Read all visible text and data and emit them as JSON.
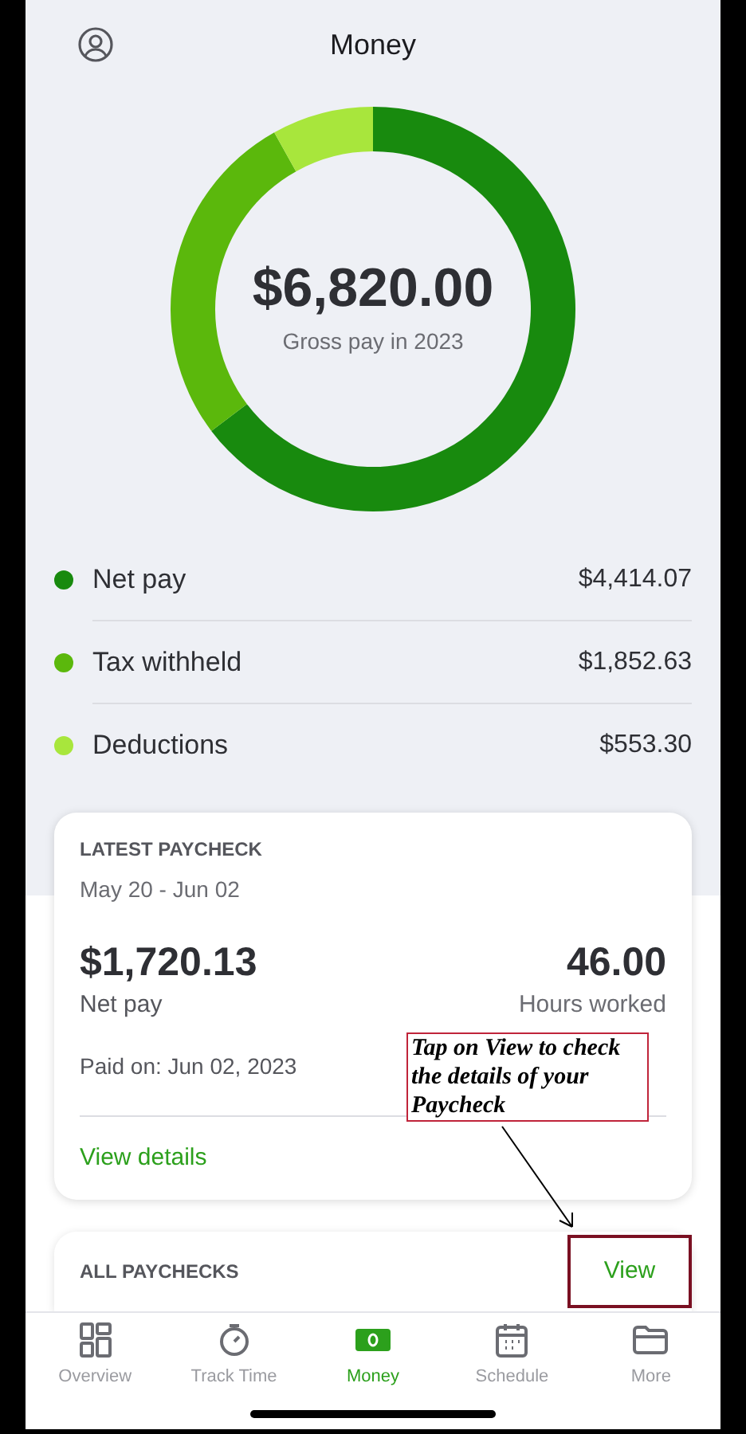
{
  "header": {
    "title": "Money"
  },
  "summary": {
    "amount": "$6,820.00",
    "caption": "Gross pay in 2023",
    "chart_data": {
      "type": "donut",
      "categories": [
        "Net pay",
        "Tax withheld",
        "Deductions"
      ],
      "values": [
        64.72,
        27.17,
        8.11
      ],
      "colors": [
        "#188a0e",
        "#5bb80c",
        "#a8e63c"
      ]
    }
  },
  "breakdown": [
    {
      "amount": "$4,414.07"
    },
    {
      "amount": "$1,852.63"
    },
    {
      "amount": "$553.30"
    }
  ],
  "latest_paycheck": {
    "title": "LATEST PAYCHECK",
    "period": "May 20 - Jun 02",
    "net_amount": "$1,720.13",
    "net_label": "Net pay",
    "hours": "46.00",
    "hours_label": "Hours worked",
    "paid_on": "Paid on: Jun 02, 2023",
    "link": "View details"
  },
  "all_paychecks": {
    "title": "ALL PAYCHECKS",
    "link": "View"
  },
  "annotation": {
    "text": "Tap on View to check the details of your Paycheck"
  },
  "nav": [
    {
      "label": "Overview",
      "kind": "grid",
      "selected": false
    },
    {
      "label": "Track Time",
      "kind": "timer",
      "selected": false
    },
    {
      "label": "Money",
      "kind": "money",
      "selected": true
    },
    {
      "label": "Schedule",
      "kind": "calendar",
      "selected": false
    },
    {
      "label": "More",
      "kind": "folder",
      "selected": false
    }
  ]
}
